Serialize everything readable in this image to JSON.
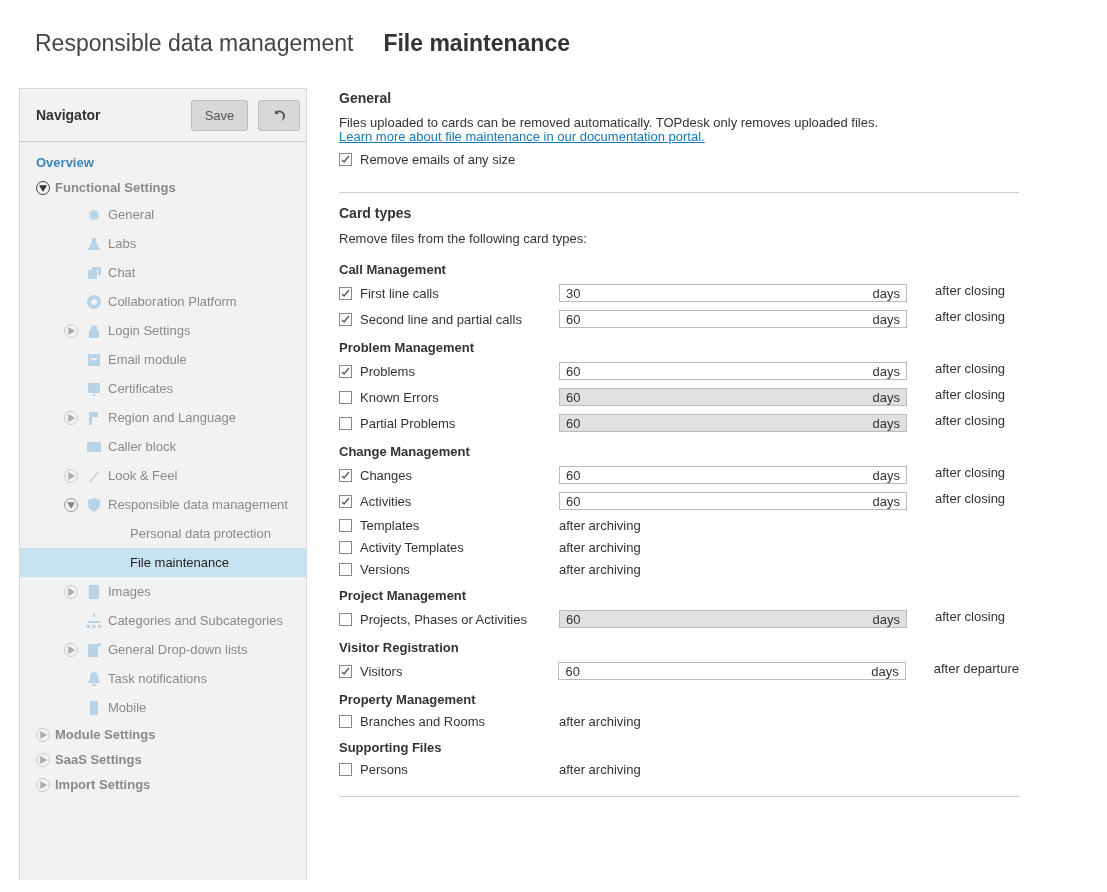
{
  "breadcrumb": {
    "parent": "Responsible data management",
    "current": "File maintenance"
  },
  "navigator": {
    "title": "Navigator",
    "save": "Save",
    "items": [
      {
        "label": "Overview",
        "kind": "link"
      },
      {
        "label": "Functional Settings",
        "kind": "group",
        "expanded": true,
        "children": [
          {
            "label": "General"
          },
          {
            "label": "Labs"
          },
          {
            "label": "Chat"
          },
          {
            "label": "Collaboration Platform"
          },
          {
            "label": "Login Settings",
            "expanded": false
          },
          {
            "label": "Email module"
          },
          {
            "label": "Certificates"
          },
          {
            "label": "Region and Language",
            "expanded": false
          },
          {
            "label": "Caller block"
          },
          {
            "label": "Look & Feel",
            "expanded": false
          },
          {
            "label": "Responsible data management",
            "expanded": true,
            "children": [
              {
                "label": "Personal data protection",
                "selected": false
              },
              {
                "label": "File maintenance",
                "selected": true
              }
            ]
          },
          {
            "label": "Images",
            "expanded": false
          },
          {
            "label": "Categories and Subcategories"
          },
          {
            "label": "General Drop-down lists",
            "expanded": false
          },
          {
            "label": "Task notifications"
          },
          {
            "label": "Mobile"
          }
        ]
      },
      {
        "label": "Module Settings",
        "kind": "group",
        "expanded": false
      },
      {
        "label": "SaaS Settings",
        "kind": "group",
        "expanded": false
      },
      {
        "label": "Import Settings",
        "kind": "group",
        "expanded": false
      }
    ]
  },
  "general": {
    "heading": "General",
    "description": "Files uploaded to cards can be removed automatically. TOPdesk only removes uploaded files. ",
    "link": "Learn more about file maintenance in our documentation portal.",
    "option": {
      "label": "Remove emails of any size",
      "checked": true
    }
  },
  "card_types": {
    "heading": "Card types",
    "intro": "Remove files from the following card types:",
    "groups": [
      {
        "title": "Call Management",
        "items": [
          {
            "label": "First line calls",
            "kind": "days",
            "checked": true,
            "value": "30",
            "unit": "days",
            "after": "after closing"
          },
          {
            "label": "Second line and partial calls",
            "kind": "days",
            "checked": true,
            "value": "60",
            "unit": "days",
            "after": "after closing"
          }
        ]
      },
      {
        "title": "Problem Management",
        "items": [
          {
            "label": "Problems",
            "kind": "days",
            "checked": true,
            "value": "60",
            "unit": "days",
            "after": "after closing"
          },
          {
            "label": "Known Errors",
            "kind": "days",
            "checked": false,
            "value": "60",
            "unit": "days",
            "after": "after closing"
          },
          {
            "label": "Partial Problems",
            "kind": "days",
            "checked": false,
            "value": "60",
            "unit": "days",
            "after": "after closing"
          }
        ]
      },
      {
        "title": "Change Management",
        "items": [
          {
            "label": "Changes",
            "kind": "days",
            "checked": true,
            "value": "60",
            "unit": "days",
            "after": "after closing"
          },
          {
            "label": "Activities",
            "kind": "days",
            "checked": true,
            "value": "60",
            "unit": "days",
            "after": "after closing"
          },
          {
            "label": "Templates",
            "kind": "archive",
            "checked": false,
            "after": "after archiving"
          },
          {
            "label": "Activity Templates",
            "kind": "archive",
            "checked": false,
            "after": "after archiving"
          },
          {
            "label": "Versions",
            "kind": "archive",
            "checked": false,
            "after": "after archiving"
          }
        ]
      },
      {
        "title": "Project Management",
        "items": [
          {
            "label": "Projects, Phases or Activities",
            "kind": "days",
            "checked": false,
            "value": "60",
            "unit": "days",
            "after": "after closing"
          }
        ]
      },
      {
        "title": "Visitor Registration",
        "items": [
          {
            "label": "Visitors",
            "kind": "days",
            "checked": true,
            "value": "60",
            "unit": "days",
            "after": "after departure"
          }
        ]
      },
      {
        "title": "Property Management",
        "items": [
          {
            "label": "Branches and Rooms",
            "kind": "archive",
            "checked": false,
            "after": "after archiving"
          }
        ]
      },
      {
        "title": "Supporting Files",
        "items": [
          {
            "label": "Persons",
            "kind": "archive",
            "checked": false,
            "after": "after archiving"
          }
        ]
      }
    ]
  }
}
